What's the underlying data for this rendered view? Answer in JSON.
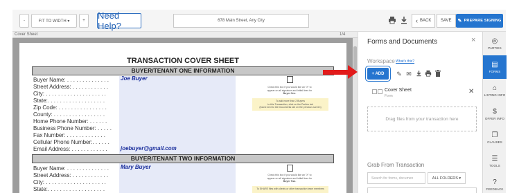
{
  "toolbar": {
    "minus_label": "-",
    "fit_label": "FIT TO WIDTH ▾",
    "plus_label": "+",
    "help_label": "Need Help?",
    "address": "678 Main Street, Any City",
    "back_label": "BACK",
    "save_label": "SAVE",
    "prepare_label": "PREPARE SIGNING"
  },
  "doc": {
    "header_left": "Cover Sheet",
    "header_right": "1/4",
    "title": "TRANSACTION COVER SHEET",
    "section1": "BUYER/TENANT ONE INFORMATION",
    "section2": "BUYER/TENANT TWO INFORMATION",
    "labels1": [
      "Buyer Name: . . . . . . . . . . . . . .",
      "Street Address: . . . . . . . . . . . .",
      "City: . . . . . . . . . . . . . . . . . . . .",
      "State:. . . . . . . . . . . . . . . . . . .",
      "Zip Code: . . . . . . . . . . . . . . . .",
      "County: . . . . . . . . . . . . . . . . .",
      "Home Phone Number: . . . . . .",
      "Business Phone Number: . . . . .",
      "Fax Number: . . . . . . . . . . . . .",
      "Cellular Phone Number:. . . . . .",
      "Email Address: . . . . . . . . . . . ."
    ],
    "buyer1_name": "Joe Buyer",
    "buyer1_email": "joebuyer@gmail.com",
    "labels2": [
      "Buyer Name: . . . . . . . . . . . . . .",
      "Street Address: . . . . . . . . . . . .",
      "City: . . . . . . . . . . . . . . . . . . . .",
      "State:. . . . . . . . . . . . . . . . . . ."
    ],
    "buyer2_name": "Mary Buyer",
    "note1_line1": "Check this box if you would like an \"X\" to",
    "note1_line2": "appear on all signature and initial lines for",
    "note1_line3": "Buyer One.",
    "yellow1_line1": "To add more than 2 Buyers",
    "yellow1_line2": "to this Transaction, click on the Parties tab",
    "yellow1_line3": "(found next to the Documents tab on the previous screen)",
    "note2_line1": "Check this box if you would like an \"X\" to",
    "note2_line2": "appear on all signature and initial lines for",
    "note2_line3": "Buyer Two.",
    "yellow2_line1": "To SHARE files with clients or other transaction team members"
  },
  "panel": {
    "title": "Forms and Documents",
    "workspace_label": "Workspace",
    "whats_this": "What's this?",
    "add_label": "+ ADD",
    "cover_name": "Cover Sheet",
    "cover_type": "Form",
    "drop_text": "Drag files from your transaction here",
    "grab_label": "Grab From Transaction",
    "search_placeholder": "Search for forms, documen",
    "folders_label": "ALL FOLDERS ▾"
  },
  "sidenav": [
    {
      "glyph": "◎",
      "label": "PARTIES"
    },
    {
      "glyph": "▤",
      "label": "FORMS"
    },
    {
      "glyph": "⌂",
      "label": "LISTING INFO"
    },
    {
      "glyph": "$",
      "label": "OFFER INFO"
    },
    {
      "glyph": "❐",
      "label": "CLAUSES"
    },
    {
      "glyph": "☰",
      "label": "TOOLS"
    },
    {
      "glyph": "?",
      "label": "FEEDBACK"
    }
  ],
  "colors": {
    "accent": "#2575cf",
    "arrow": "#e21b1b",
    "field_value": "#1a2e9c"
  }
}
